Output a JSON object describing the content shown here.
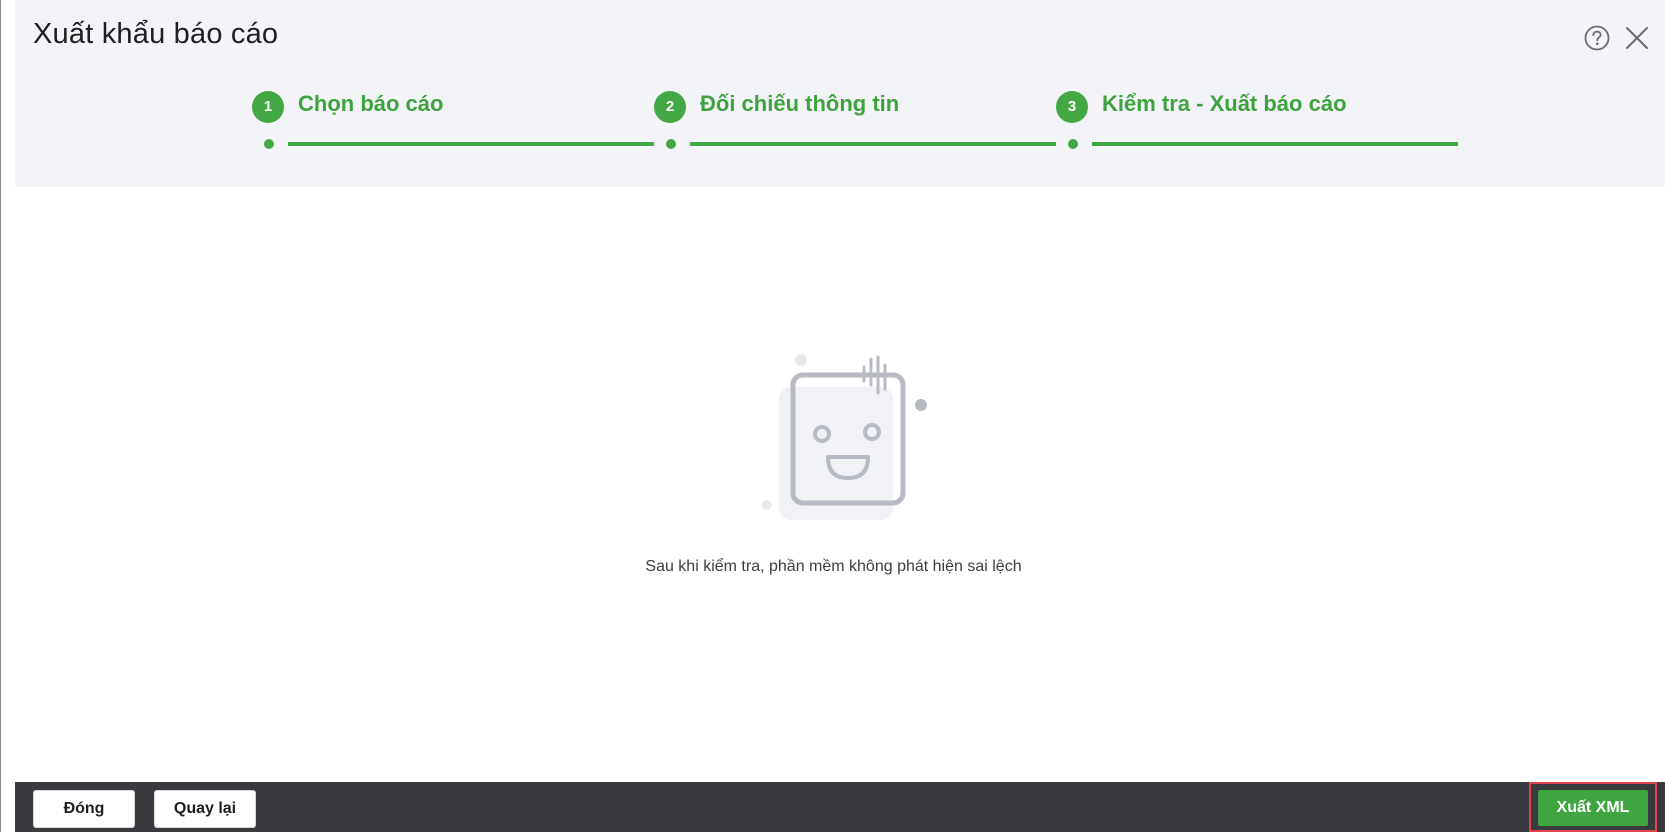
{
  "dialog": {
    "title": "Xuất khẩu báo cáo",
    "help_icon": "help-circle-icon",
    "close_icon": "close-icon"
  },
  "steps": [
    {
      "number": "1",
      "label": "Chọn báo cáo"
    },
    {
      "number": "2",
      "label": "Đối chiếu thông tin"
    },
    {
      "number": "3",
      "label": "Kiểm tra - Xuất báo cáo"
    }
  ],
  "empty_state": {
    "illustration": "smiling-notepad-illustration",
    "message": "Sau khi kiểm tra, phần mềm không phát hiện sai lệch"
  },
  "footer": {
    "close_label": "Đóng",
    "back_label": "Quay lại",
    "export_label": "Xuất XML"
  },
  "colors": {
    "accent": "#43a844",
    "footer_bg": "#3a3b3e",
    "highlight": "#e0434b"
  }
}
